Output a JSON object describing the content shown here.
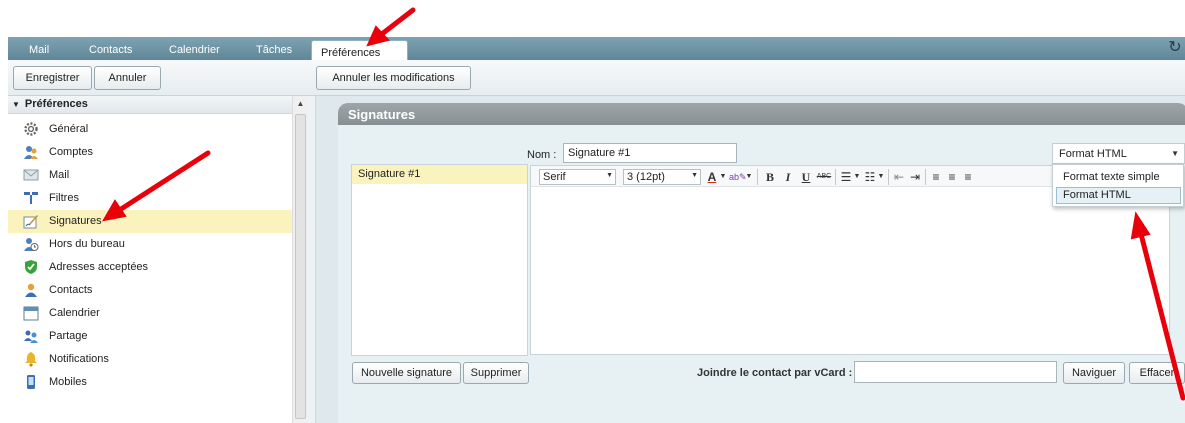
{
  "tabs": [
    {
      "label": "Mail"
    },
    {
      "label": "Contacts"
    },
    {
      "label": "Calendrier"
    },
    {
      "label": "Tâches"
    },
    {
      "label": "Préférences",
      "active": true
    }
  ],
  "toolbar": {
    "save_label": "Enregistrer",
    "cancel_label": "Annuler",
    "undo_changes_label": "Annuler les modifications"
  },
  "sidebar": {
    "header": "Préférences",
    "items": [
      {
        "label": "Général",
        "icon": "gear-icon"
      },
      {
        "label": "Comptes",
        "icon": "accounts-icon"
      },
      {
        "label": "Mail",
        "icon": "mail-icon"
      },
      {
        "label": "Filtres",
        "icon": "filter-icon"
      },
      {
        "label": "Signatures",
        "icon": "signature-icon",
        "selected": true
      },
      {
        "label": "Hors du bureau",
        "icon": "out-of-office-icon"
      },
      {
        "label": "Adresses acceptées",
        "icon": "shield-check-icon"
      },
      {
        "label": "Contacts",
        "icon": "contact-icon"
      },
      {
        "label": "Calendrier",
        "icon": "calendar-icon"
      },
      {
        "label": "Partage",
        "icon": "sharing-icon"
      },
      {
        "label": "Notifications",
        "icon": "bell-icon"
      },
      {
        "label": "Mobiles",
        "icon": "mobile-icon"
      }
    ]
  },
  "signatures": {
    "title": "Signatures",
    "list": [
      "Signature #1"
    ],
    "name_label": "Nom :",
    "name_value": "Signature #1",
    "format_selected": "Format HTML",
    "format_options": [
      "Format texte simple",
      "Format HTML"
    ],
    "editor": {
      "font": "Serif",
      "size": "3 (12pt)"
    },
    "new_signature_label": "Nouvelle signature",
    "delete_label": "Supprimer",
    "vcard_label": "Joindre le contact par vCard :",
    "browse_label": "Naviguer",
    "clear_label": "Effacer"
  },
  "colors": {
    "topbar": "#6b90a1",
    "selected_row": "#fbf3bd",
    "annotation_arrow": "#e8000b",
    "panel_header": "#8f979b"
  }
}
